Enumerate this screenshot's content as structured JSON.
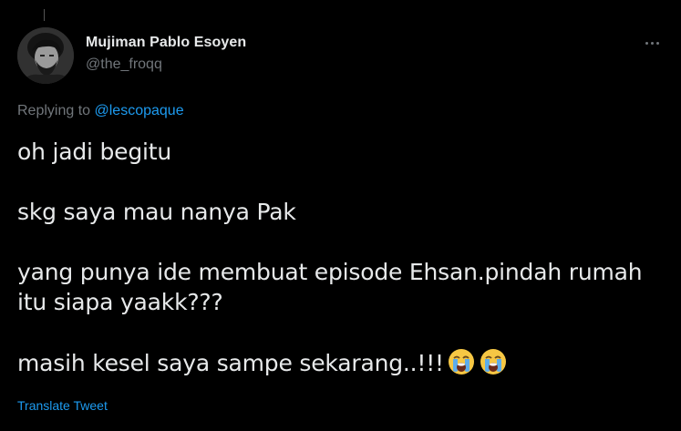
{
  "tweet": {
    "author": {
      "display_name": "Mujiman Pablo Esoyen",
      "handle": "@the_froqq",
      "avatar_icon": "user-avatar-photo"
    },
    "more_icon": "more-options-icon",
    "replying_to_prefix": "Replying to",
    "replying_to_handle": "@lescopaque",
    "paragraphs": [
      "oh jadi begitu",
      "skg saya mau nanya Pak",
      "yang punya ide membuat episode Ehsan.pindah rumah",
      "itu siapa yaakk???",
      "masih kesel saya sampe sekarang..!!!"
    ],
    "trailing_emojis": [
      "loudly-crying-face-icon",
      "loudly-crying-face-icon"
    ],
    "translate_label": "Translate Tweet"
  },
  "colors": {
    "background": "#000000",
    "primary_text": "#e7e9ea",
    "secondary_text": "#71767b",
    "accent": "#1d9bf0"
  }
}
